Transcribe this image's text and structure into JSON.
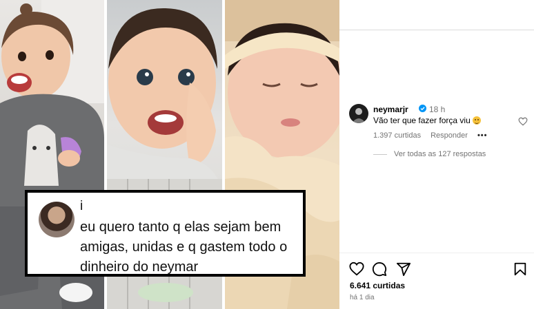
{
  "quote_card": {
    "name": "i",
    "text": "eu quero tanto q elas sejam bem amigas, unidas e q gastem todo o dinheiro do neymar"
  },
  "comment": {
    "username": "neymarjr",
    "time": "18 h",
    "text": "Vão ter que fazer força viu",
    "emoji": "grinning-face-emoji",
    "likes": "1.397 curtidas",
    "reply_label": "Responder",
    "more_label": "•••"
  },
  "replies": {
    "label": "Ver todas as 127 respostas"
  },
  "post": {
    "likes": "6.641 curtidas",
    "date": "há 1 dia"
  },
  "colors": {
    "verified": "#0095f6",
    "muted_text": "#737373",
    "divider": "#dbdbdb"
  }
}
